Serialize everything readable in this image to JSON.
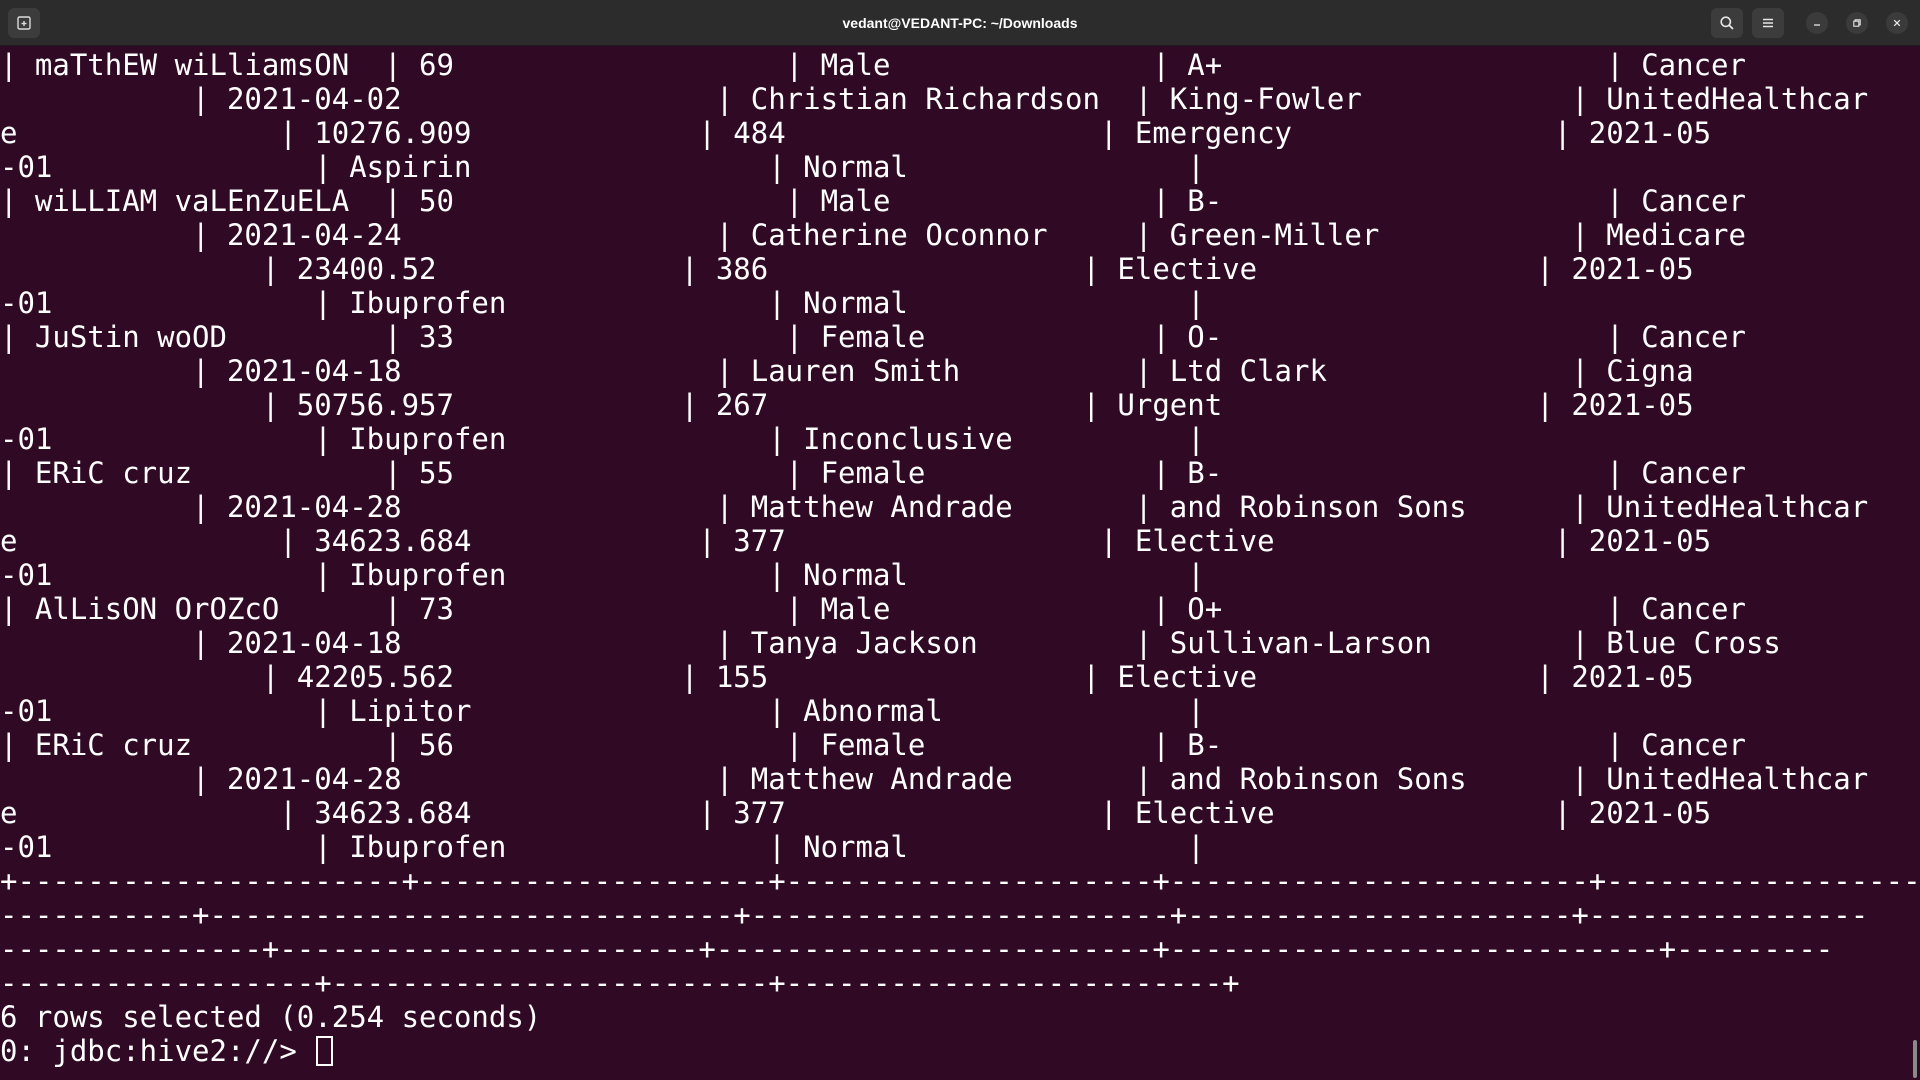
{
  "window": {
    "title": "vedant@VEDANT-PC: ~/Downloads"
  },
  "icons": {
    "new_tab": "terminal-new-tab-icon",
    "search": "search-icon",
    "menu": "hamburger-menu-icon",
    "minimize": "minimize-icon",
    "maximize": "maximize-icon",
    "close": "close-icon"
  },
  "colors": {
    "terminal_background": "#300a24",
    "terminal_foreground": "#ffffff",
    "titlebar_background": "#2c2c2c"
  },
  "terminal": {
    "lines": [
      "| maTthEW wiLliamsON  | 69                   | Male               | A+                      | Cancer",
      "           | 2021-04-02                  | Christian Richardson  | King-Fowler            | UnitedHealthcar",
      "e               | 10276.909             | 484                  | Emergency               | 2021-05",
      "-01               | Aspirin                 | Normal                |",
      "| wiLLIAM vaLEnZuELA  | 50                   | Male               | B-                      | Cancer",
      "           | 2021-04-24                  | Catherine Oconnor     | Green-Miller           | Medicare",
      "               | 23400.52              | 386                  | Elective                | 2021-05",
      "-01               | Ibuprofen               | Normal                |",
      "| JuStin woOD         | 33                   | Female             | O-                      | Cancer",
      "           | 2021-04-18                  | Lauren Smith          | Ltd Clark              | Cigna",
      "               | 50756.957             | 267                  | Urgent                  | 2021-05",
      "-01               | Ibuprofen               | Inconclusive          |",
      "| ERiC cruz           | 55                   | Female             | B-                      | Cancer",
      "           | 2021-04-28                  | Matthew Andrade       | and Robinson Sons      | UnitedHealthcar",
      "e               | 34623.684             | 377                  | Elective                | 2021-05",
      "-01               | Ibuprofen               | Normal                |",
      "| AlLisON OrOZcO      | 73                   | Male               | O+                      | Cancer",
      "           | 2021-04-18                  | Tanya Jackson         | Sullivan-Larson        | Blue Cross",
      "               | 42205.562             | 155                  | Elective                | 2021-05",
      "-01               | Lipitor                 | Abnormal              |",
      "| ERiC cruz           | 56                   | Female             | B-                      | Cancer",
      "           | 2021-04-28                  | Matthew Andrade       | and Robinson Sons      | UnitedHealthcar",
      "e               | 34623.684             | 377                  | Elective                | 2021-05",
      "-01               | Ibuprofen               | Normal                |",
      "+----------------------+--------------------+---------------------+------------------------+-------------------",
      "-----------+------------------------------+------------------------+----------------------+----------------",
      "---------------+------------------------+-------------------------+----------------------------+---------",
      "------------------+-------------------------+-------------------------+",
      "6 rows selected (0.254 seconds)"
    ],
    "prompt": "0: jdbc:hive2://> "
  }
}
